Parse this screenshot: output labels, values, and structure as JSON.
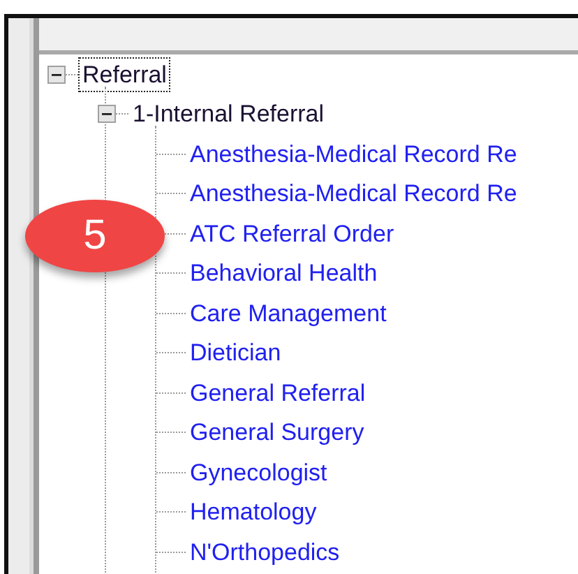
{
  "tree": {
    "nodes": [
      {
        "kind": "group",
        "label": "Referral",
        "expanded": true,
        "selected": true,
        "children": [
          {
            "kind": "group",
            "label": "1-Internal Referral",
            "expanded": true,
            "selected": false,
            "children": [
              {
                "kind": "item",
                "label": "Anesthesia-Medical Record Re",
                "selected": false
              },
              {
                "kind": "item",
                "label": "Anesthesia-Medical Record Re",
                "selected": false
              },
              {
                "kind": "item",
                "label": "ATC Referral Order",
                "selected": false
              },
              {
                "kind": "item",
                "label": "Behavioral Health",
                "selected": false
              },
              {
                "kind": "item",
                "label": "Care Management",
                "selected": false
              },
              {
                "kind": "item",
                "label": "Dietician",
                "selected": false
              },
              {
                "kind": "item",
                "label": "General Referral",
                "selected": false
              },
              {
                "kind": "item",
                "label": "General Surgery",
                "selected": false
              },
              {
                "kind": "item",
                "label": "Gynecologist",
                "selected": false
              },
              {
                "kind": "item",
                "label": "Hematology",
                "selected": false
              },
              {
                "kind": "item",
                "label": "N'Orthopedics",
                "selected": false
              }
            ]
          }
        ]
      }
    ]
  },
  "badge": {
    "text": "5"
  }
}
